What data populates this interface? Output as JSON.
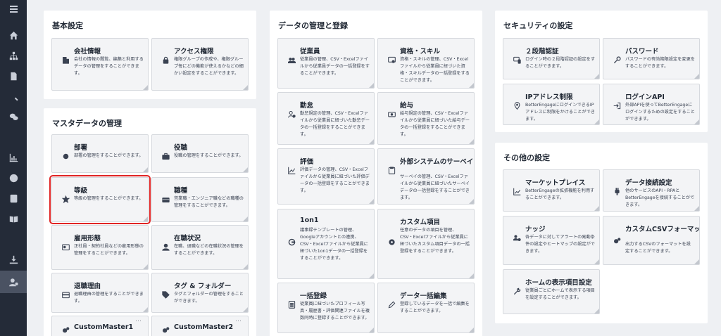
{
  "sidebar": {
    "items": [
      {
        "name": "home-icon"
      },
      {
        "name": "org-chart-icon"
      },
      {
        "name": "document-icon"
      },
      {
        "name": "search-icon"
      },
      {
        "name": "chat-icon"
      },
      {
        "name": "link-icon"
      },
      {
        "name": "bar-chart-icon"
      },
      {
        "name": "pie-chart-icon"
      },
      {
        "name": "id-card-icon"
      },
      {
        "name": "book-icon"
      },
      {
        "name": "mail-icon"
      },
      {
        "name": "download-icon"
      },
      {
        "name": "user-settings-icon"
      }
    ]
  },
  "basic": {
    "title": "基本設定",
    "cards": [
      {
        "title": "会社情報",
        "desc": "会社の情報の閲覧、編集と利用するデータの管理をすることができます。"
      },
      {
        "title": "アクセス権限",
        "desc": "権限グループの作成や、権限グループ毎にどの機能が使えるかなどの細かい設定をすることができます。"
      }
    ]
  },
  "master": {
    "title": "マスタデータの管理",
    "cards": [
      {
        "title": "部署",
        "desc": "部署の管理をすることができます。"
      },
      {
        "title": "役職",
        "desc": "役職の管理をすることができます。"
      },
      {
        "title": "等級",
        "desc": "等級の管理をすることができます。"
      },
      {
        "title": "職種",
        "desc": "営業職・エンジニア職などの職種の管理をすることができます。"
      },
      {
        "title": "雇用形態",
        "desc": "正社員・契約社員などの雇用形態の管理をすることができます。"
      },
      {
        "title": "在職状況",
        "desc": "在職、退職などの在職状況の管理をすることができます。"
      },
      {
        "title": "退職理由",
        "desc": "退職理由の管理をすることができます。"
      },
      {
        "title": "タグ & フォルダー",
        "desc": "タグとフォルダーの管理をすることができます。"
      },
      {
        "title": "CustomMaster1",
        "desc": "",
        "dots": "…"
      },
      {
        "title": "CustomMaster2",
        "desc": "",
        "dots": "…"
      }
    ]
  },
  "data_mgmt": {
    "title": "データの管理と登録",
    "cards": [
      {
        "title": "従業員",
        "desc": "従業員の管理、CSV・Excelファイルから従業員データの一括登録をすることができます。"
      },
      {
        "title": "資格・スキル",
        "desc": "資格・スキルの管理、CSV・Excelファイルから従業員に紐づいた資格・スキルデータの一括登録をすることができます。"
      },
      {
        "title": "勤怠",
        "desc": "勤怠規定の管理、CSV・Excelファイルから従業員に紐づいた勤怠データの一括登録をすることができます。"
      },
      {
        "title": "給与",
        "desc": "給与規定の管理、CSV・Excelファイルから従業員に紐づいた給与データの一括登録をすることができます。"
      },
      {
        "title": "評価",
        "desc": "評価データの管理、CSV・Excelファイルから従業員に紐づいた評価データの一括登録をすることができます。"
      },
      {
        "title": "外部システムのサーベイ",
        "desc": "サーベイの管理、CSV・Excelファイルから従業員に紐づいたサーベイデータの一括登録をすることができます。"
      },
      {
        "title": "1on1",
        "desc": "議事録テンプレートの管理、Googleアカウントとの連携、CSV・Excelファイルから従業員に紐づいた1on1データの一括登録をすることができます。"
      },
      {
        "title": "カスタム項目",
        "desc": "任意のデータの項目を管理、CSV・Excelファイルから従業員に紐づいたカスタム項目データの一括登録をすることができます。"
      },
      {
        "title": "一括登録",
        "desc": "従業員に紐づいたプロフィール写真・履歴書・評価関連ファイルを複数同時に登録することができます。"
      },
      {
        "title": "データ一括編集",
        "desc": "登録しているデータを一括で編集をすることができます。"
      }
    ]
  },
  "security": {
    "title": "セキュリティの設定",
    "cards": [
      {
        "title": "２段階認証",
        "desc": "ログイン時の２段階認証の設定をすることができます。"
      },
      {
        "title": "パスワード",
        "desc": "パスワードの有効期限設定を変更をすることができます。"
      },
      {
        "title": "IPアドレス制限",
        "desc": "BetterEngageにログインできるIPアドレスに制限をかけることができます。"
      },
      {
        "title": "ログインAPI",
        "desc": "外部APIを使ってBetterEngageにログインするための設定をすることができます。"
      }
    ]
  },
  "other": {
    "title": "その他の設定",
    "cards": [
      {
        "title": "マーケットプレイス",
        "desc": "BetterEngageの拡張機能を利用することができます。"
      },
      {
        "title": "データ接続設定",
        "desc": "他のサービスのAPI・RPAとBetterEngageを接続することができます。"
      },
      {
        "title": "ナッジ",
        "desc": "各データに対してアラートの発動条件の設定やヒートマップの設定ができます。"
      },
      {
        "title": "カスタムCSVフォーマット",
        "desc": "出力するCSVのフォーマットを設定することができます。"
      },
      {
        "title": "ホームの表示項目設定",
        "desc": "従業員ごとにホームで表示する項目を設定することができます。"
      }
    ]
  }
}
